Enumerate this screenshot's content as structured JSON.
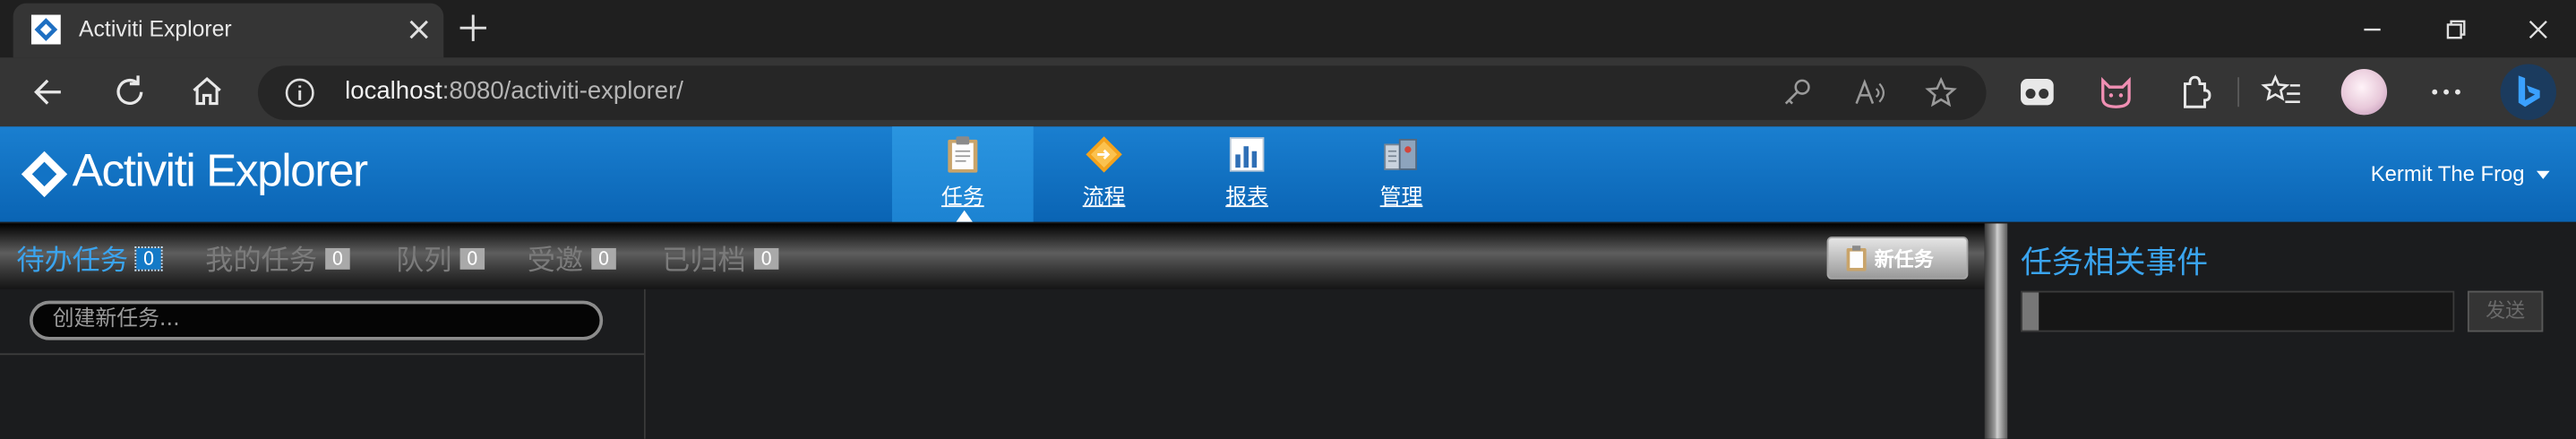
{
  "browser": {
    "tab_title": "Activiti Explorer",
    "url_host": "localhost",
    "url_rest": ":8080/activiti-explorer/",
    "icons": [
      "back-icon",
      "reload-icon",
      "home-icon",
      "info-icon",
      "key-icon",
      "read-aloud-icon",
      "favorite-star-icon",
      "extension-icon",
      "collections-icon",
      "bing-icon"
    ]
  },
  "app": {
    "logo_text": "Activiti Explorer",
    "nav": [
      {
        "label": "任务",
        "icon": "clipboard-icon"
      },
      {
        "label": "流程",
        "icon": "process-diamond-icon"
      },
      {
        "label": "报表",
        "icon": "bar-chart-icon"
      },
      {
        "label": "管理",
        "icon": "manage-icon"
      }
    ],
    "active_nav": "任务",
    "user": "Kermit The Frog",
    "accent": "#3aa4ef",
    "header_blue": "#0a64b4"
  },
  "tasks": {
    "filters": [
      {
        "label": "待办任务",
        "count": "0"
      },
      {
        "label": "我的任务",
        "count": "0"
      },
      {
        "label": "队列",
        "count": "0"
      },
      {
        "label": "受邀",
        "count": "0"
      },
      {
        "label": "已归档",
        "count": "0"
      }
    ],
    "new_task_label": "新任务",
    "new_task_placeholder": "创建新任务..."
  },
  "events": {
    "title": "任务相关事件",
    "send_label": "发送"
  }
}
